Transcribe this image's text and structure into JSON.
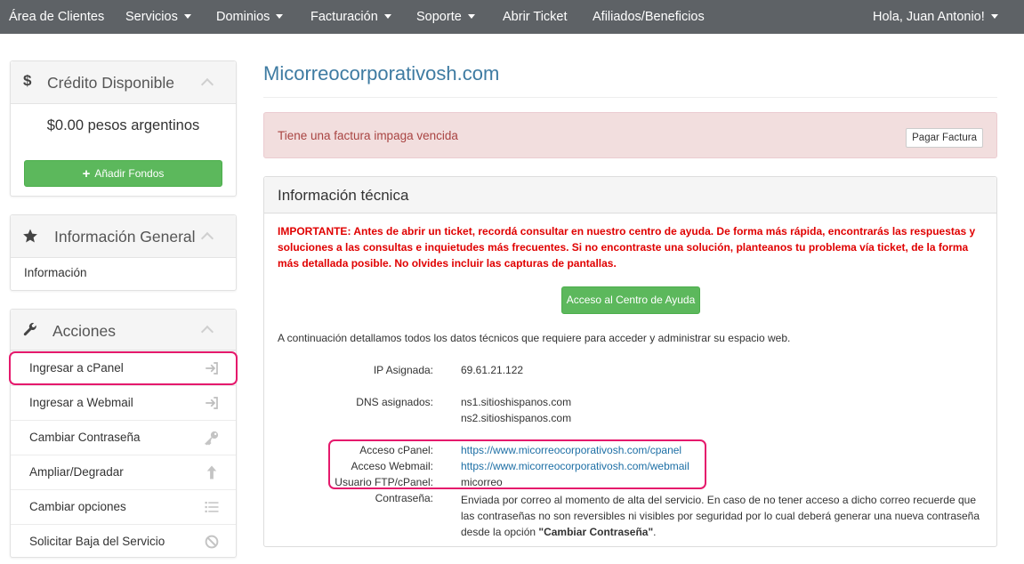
{
  "nav": {
    "items": [
      {
        "label": "Área de Clientes",
        "dropdown": false
      },
      {
        "label": "Servicios",
        "dropdown": true
      },
      {
        "label": "Dominios",
        "dropdown": true
      },
      {
        "label": "Facturación",
        "dropdown": true
      },
      {
        "label": "Soporte",
        "dropdown": true
      },
      {
        "label": "Abrir Ticket",
        "dropdown": false
      },
      {
        "label": "Afiliados/Beneficios",
        "dropdown": false
      }
    ],
    "user": "Hola, Juan Antonio!"
  },
  "sidebar": {
    "credit": {
      "title": "Crédito Disponible",
      "icon": "dollar-icon",
      "amount": "$0.00 pesos argentinos",
      "add_funds": "Añadir Fondos"
    },
    "general": {
      "title": "Información General",
      "icon": "star-icon",
      "link": "Información"
    },
    "actions": {
      "title": "Acciones",
      "icon": "wrench-icon",
      "items": [
        {
          "label": "Ingresar a cPanel",
          "icon": "sign-in-icon"
        },
        {
          "label": "Ingresar a Webmail",
          "icon": "sign-in-icon"
        },
        {
          "label": "Cambiar Contraseña",
          "icon": "key-icon"
        },
        {
          "label": "Ampliar/Degradar",
          "icon": "arrow-up-icon"
        },
        {
          "label": "Cambiar opciones",
          "icon": "list-icon"
        },
        {
          "label": "Solicitar Baja del Servicio",
          "icon": "ban-icon"
        }
      ]
    }
  },
  "main": {
    "title": "Micorreocorporativosh.com",
    "alert": {
      "text": "Tiene una factura impaga vencida",
      "button": "Pagar Factura"
    },
    "tech": {
      "title": "Información técnica",
      "important": "IMPORTANTE: Antes de abrir un ticket, recordá consultar en nuestro centro de ayuda. De forma más rápida, encontrarás las respuestas y soluciones a las consultas e inquietudes más frecuentes. Si no encontraste una solución, planteanos tu problema vía ticket, de la forma más detallada posible. No olvides incluir las capturas de pantallas.",
      "help_button": "Acceso al Centro de Ayuda",
      "intro": "A continuación detallamos todos los datos técnicos que requiere para acceder y administrar su espacio web.",
      "ip_label": "IP Asignada:",
      "ip": "69.61.21.122",
      "dns_label": "DNS asignados:",
      "dns1": "ns1.sitioshispanos.com",
      "dns2": "ns2.sitioshispanos.com",
      "cpanel_label": "Acceso cPanel:",
      "cpanel_url": "https://www.micorreocorporativosh.com/cpanel",
      "webmail_label": "Acceso Webmail:",
      "webmail_url": "https://www.micorreocorporativosh.com/webmail",
      "ftp_label": "Usuario FTP/cPanel:",
      "ftp_user": "micorreo",
      "password_label": "Contraseña:",
      "password_text_1": "Enviada por correo al momento de alta del servicio. En caso de no tener acceso a dicho correo recuerde que las contraseñas no son reversibles ni visibles por seguridad por lo cual deberá generar una nueva contraseña desde la opción ",
      "password_text_bold": "\"Cambiar Contraseña\"",
      "password_text_2": "."
    }
  },
  "colors": {
    "nav_bg": "#5e6266",
    "title_blue": "#3e7ba2",
    "link_blue": "#1d6fa5",
    "alert_bg": "#f2dede",
    "alert_text": "#a94442",
    "important_red": "#e00000",
    "green": "#5cb85c",
    "highlight": "#e5196c"
  }
}
